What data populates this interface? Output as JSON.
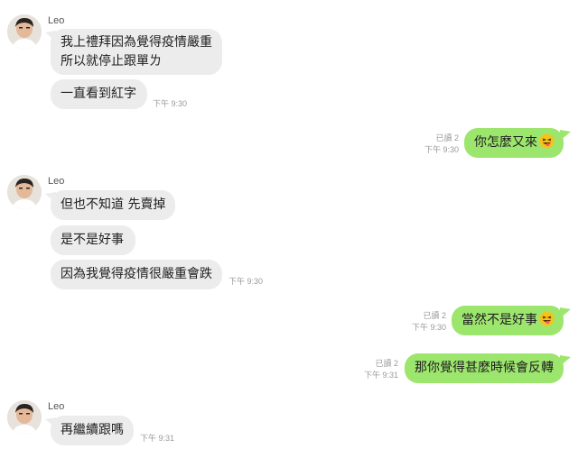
{
  "sender": {
    "name": "Leo",
    "avatar_icon": "user-photo-icon"
  },
  "colors": {
    "incoming_bubble": "#ececec",
    "outgoing_bubble": "#9de66e",
    "meta": "#9a9a9a"
  },
  "messages": {
    "m1": {
      "text_line1": "我上禮拜因為覺得疫情嚴重",
      "text_line2": "所以就停止跟單ㄌ"
    },
    "m2": {
      "text": "一直看到紅字",
      "time": "下午 9:30"
    },
    "m3": {
      "text": "你怎麼又來",
      "emoji": "grinning-face-with-tongue-icon",
      "read": "已讀 2",
      "time": "下午 9:30"
    },
    "m4": {
      "text": "但也不知道 先賣掉"
    },
    "m5": {
      "text": "是不是好事"
    },
    "m6": {
      "text": "因為我覺得疫情很嚴重會跌",
      "time": "下午 9:30"
    },
    "m7": {
      "text": "當然不是好事",
      "emoji": "grinning-face-with-tongue-icon",
      "read": "已讀 2",
      "time": "下午 9:30"
    },
    "m8": {
      "text": "那你覺得甚麼時候會反轉",
      "read": "已讀 2",
      "time": "下午 9:31"
    },
    "m9": {
      "text": "再繼續跟嗎",
      "time": "下午 9:31"
    }
  }
}
